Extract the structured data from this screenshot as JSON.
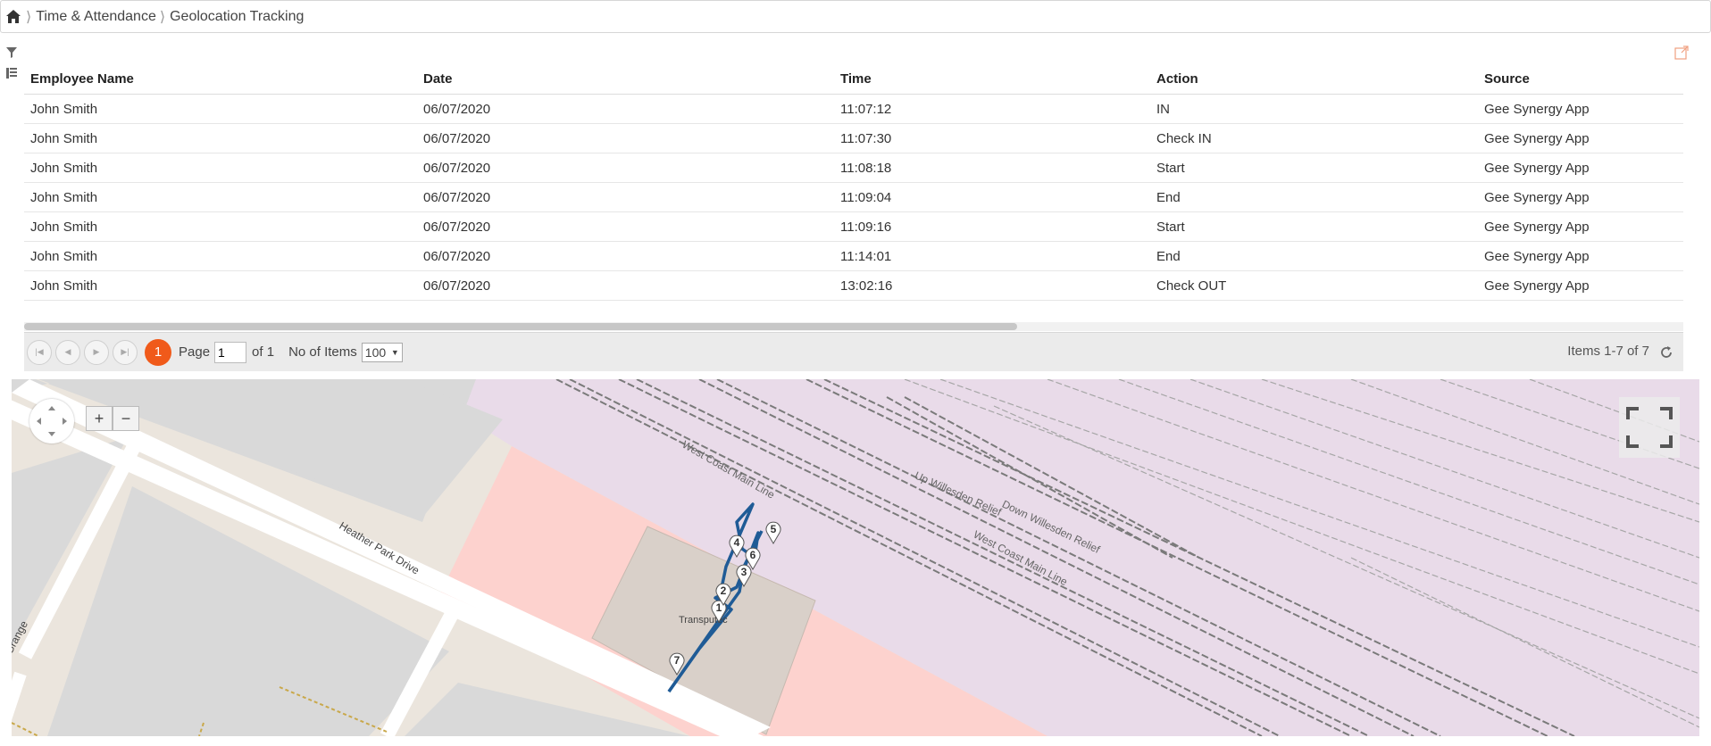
{
  "breadcrumb": {
    "items": [
      "Time & Attendance",
      "Geolocation Tracking"
    ]
  },
  "grid": {
    "columns": [
      "Employee Name",
      "Date",
      "Time",
      "Action",
      "Source"
    ],
    "rows": [
      [
        "John Smith",
        "06/07/2020",
        "11:07:12",
        "IN",
        "Gee Synergy App"
      ],
      [
        "John Smith",
        "06/07/2020",
        "11:07:30",
        "Check IN",
        "Gee Synergy App"
      ],
      [
        "John Smith",
        "06/07/2020",
        "11:08:18",
        "Start",
        "Gee Synergy App"
      ],
      [
        "John Smith",
        "06/07/2020",
        "11:09:04",
        "End",
        "Gee Synergy App"
      ],
      [
        "John Smith",
        "06/07/2020",
        "11:09:16",
        "Start",
        "Gee Synergy App"
      ],
      [
        "John Smith",
        "06/07/2020",
        "11:14:01",
        "End",
        "Gee Synergy App"
      ],
      [
        "John Smith",
        "06/07/2020",
        "13:02:16",
        "Check OUT",
        "Gee Synergy App"
      ]
    ]
  },
  "pager": {
    "current_page": "1",
    "page_label": "Page",
    "page_value": "1",
    "of_label": "of 1",
    "items_label": "No of Items",
    "page_size": "100",
    "summary": "Items 1-7 of 7"
  },
  "map": {
    "zoom_in": "+",
    "zoom_out": "−",
    "street_labels": [
      "Heather Park Drive",
      "West Coast Main Line",
      "Up Willesden Relief",
      "Down Willesden Relief",
      "West Coast Main Line",
      "Transputec",
      "Grange"
    ],
    "markers": [
      "1",
      "2",
      "3",
      "4",
      "5",
      "6",
      "7"
    ],
    "track_color": "#1f5b96",
    "accent_color": "#f05a1a"
  }
}
